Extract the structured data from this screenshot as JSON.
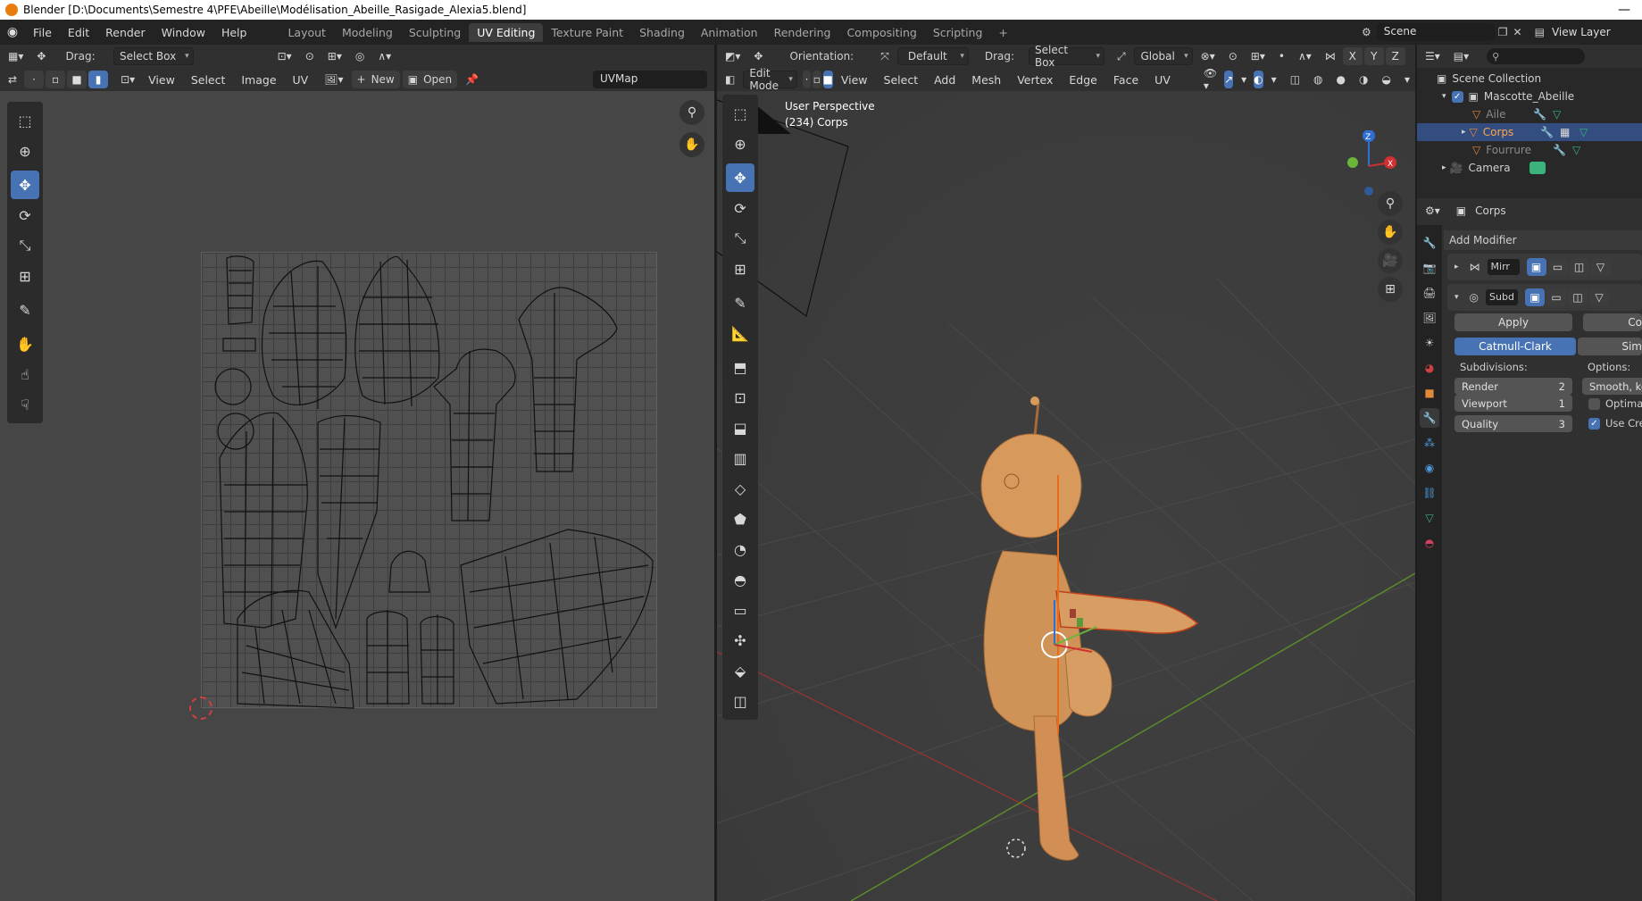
{
  "window": {
    "title": "Blender [D:\\Documents\\Semestre 4\\PFE\\Abeille\\Modélisation_Abeille_Rasigade_Alexia5.blend]",
    "minimize": "—"
  },
  "menu": [
    "File",
    "Edit",
    "Render",
    "Window",
    "Help"
  ],
  "workspaces": [
    {
      "label": "Layout"
    },
    {
      "label": "Modeling"
    },
    {
      "label": "Sculpting"
    },
    {
      "label": "UV Editing",
      "active": true
    },
    {
      "label": "Texture Paint"
    },
    {
      "label": "Shading"
    },
    {
      "label": "Animation"
    },
    {
      "label": "Rendering"
    },
    {
      "label": "Compositing"
    },
    {
      "label": "Scripting"
    },
    {
      "label": "+"
    }
  ],
  "scene": {
    "name": "Scene",
    "view_layer": "View Layer"
  },
  "uv_editor": {
    "drag_label": "Drag:",
    "drag_value": "Select Box",
    "menus": [
      "View",
      "Select",
      "Image",
      "UV"
    ],
    "new_label": "New",
    "open_label": "Open",
    "uvmap": "UVMap"
  },
  "view3d": {
    "orientation_label": "Orientation:",
    "orientation_value": "Default",
    "drag_label": "Drag:",
    "drag_value": "Select Box",
    "transform_space": "Global",
    "mode": "Edit Mode",
    "menus": [
      "View",
      "Select",
      "Add",
      "Mesh",
      "Vertex",
      "Edge",
      "Face",
      "UV"
    ],
    "overlay_title": "User Perspective",
    "overlay_object": "(234) Corps",
    "gizmo": {
      "x": "X",
      "y": "Y",
      "z": "Z"
    }
  },
  "outliner": {
    "search_placeholder": "",
    "collection": "Scene Collection",
    "items": [
      {
        "label": "Mascotte_Abeille"
      },
      {
        "label": "Aile"
      },
      {
        "label": "Corps"
      },
      {
        "label": "Fourrure"
      },
      {
        "label": "Camera"
      }
    ]
  },
  "properties": {
    "object_name": "Corps",
    "add_modifier": "Add Modifier",
    "modifiers": [
      {
        "name": "Mirr"
      },
      {
        "name": "Subd"
      }
    ],
    "apply": "Apply",
    "copy": "Co",
    "catmull": "Catmull-Clark",
    "simple": "Sim",
    "subdivisions_label": "Subdivisions:",
    "options_label": "Options:",
    "render": {
      "label": "Render",
      "value": "2"
    },
    "viewport": {
      "label": "Viewport",
      "value": "1"
    },
    "quality": {
      "label": "Quality",
      "value": "3"
    },
    "smooth": "Smooth, kee",
    "optimal": "Optimal",
    "use_crease": "Use Crea"
  }
}
